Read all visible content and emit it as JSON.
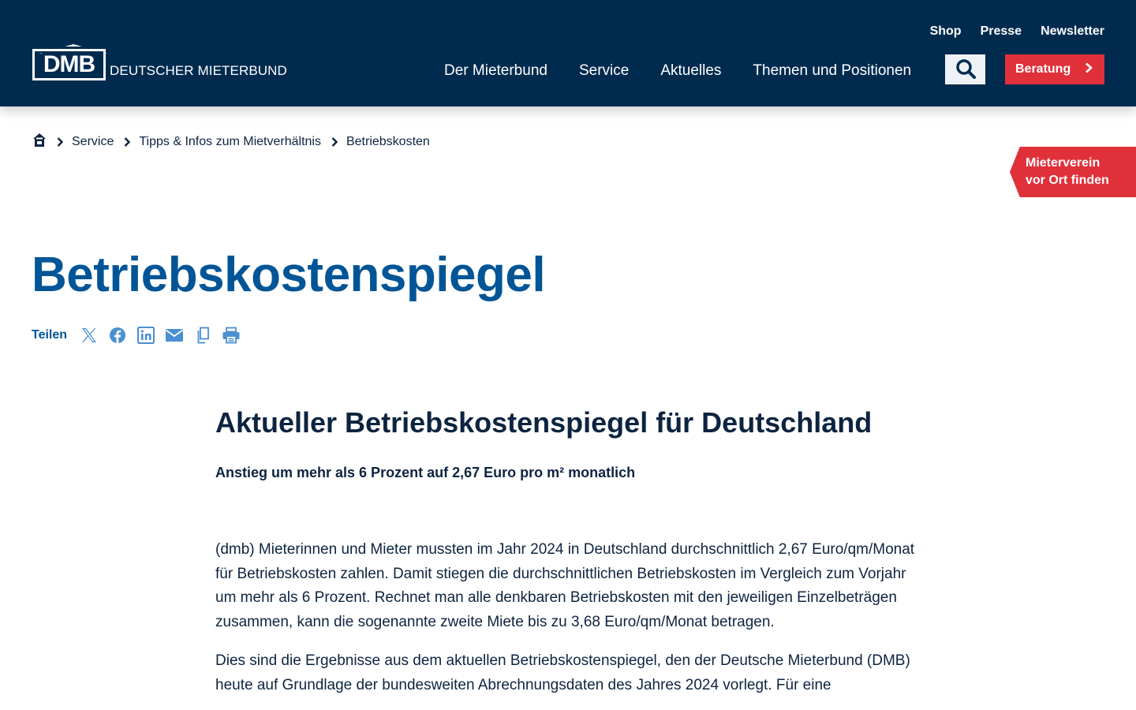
{
  "header": {
    "logo_mark": "DMB",
    "logo_text": "DEUTSCHER MIETERBUND",
    "top_links": [
      "Shop",
      "Presse",
      "Newsletter"
    ],
    "main_nav": [
      "Der Mieterbund",
      "Service",
      "Aktuelles",
      "Themen und Positionen"
    ],
    "beratung_label": "Beratung",
    "colors": {
      "header_bg": "#002b4f",
      "accent_red": "#e0313b",
      "title_blue": "#005596"
    }
  },
  "breadcrumb": {
    "home_icon": "home-icon",
    "items": [
      "Service",
      "Tipps & Infos zum Mietverhältnis",
      "Betriebskosten"
    ]
  },
  "side_tab": {
    "line1": "Mieterverein",
    "line2": "vor Ort finden"
  },
  "page": {
    "title": "Betriebskostenspiegel",
    "share_label": "Teilen",
    "share_icons": [
      "x-twitter-icon",
      "facebook-icon",
      "linkedin-icon",
      "mail-icon",
      "copy-icon",
      "print-icon"
    ]
  },
  "article": {
    "heading": "Aktueller Betriebskostenspiegel für Deutschland",
    "lead": "Anstieg um mehr als 6 Prozent auf 2,67 Euro pro m² monatlich",
    "paragraph1": "(dmb) Mieterinnen und Mieter mussten im Jahr 2024 in Deutschland durchschnittlich 2,67 Euro/qm/Monat für Betriebskosten zahlen. Damit stiegen die durchschnittlichen Betriebskosten im Vergleich zum Vorjahr um mehr als 6 Prozent. Rechnet man alle denkbaren Betriebskosten mit den je­weiligen Einzelbeträgen zusammen, kann die sogenannte zweite Miete bis zu 3,68 Euro/qm/Monat betragen.",
    "paragraph2": "Dies sind die Ergebnisse aus dem aktuellen Betriebskostenspiegel, den der Deutsche Mieterbund (DMB) heute auf Grundlage der bundesweiten Abrechnungsdaten des Jahres 2024 vorlegt. Für eine"
  }
}
